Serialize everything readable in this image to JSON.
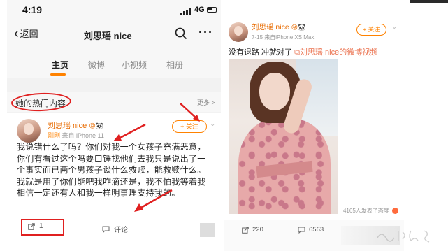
{
  "left": {
    "status": {
      "time": "4:19",
      "network": "4G"
    },
    "nav": {
      "back_label": "返回",
      "title": "刘思瑶 nice"
    },
    "tabs": [
      {
        "label": "主页",
        "active": true
      },
      {
        "label": "微博",
        "active": false
      },
      {
        "label": "小视频",
        "active": false
      },
      {
        "label": "相册",
        "active": false
      }
    ],
    "hot_section": {
      "title": "她的热门内容",
      "more_label": "更多 >"
    },
    "post": {
      "author": "刘思瑶 nice",
      "author_badges": "😝🐼",
      "time_label": "刚刚",
      "source": "来自 iPhone 11",
      "follow_label": "+ 关注",
      "text": "我说错什么了吗？你们对我一个女孩子充满恶意，你们有看过这个吗要口锤找他们去我只是说出了一个事实而已两个男孩子谈什么救赎，能救赎什么。我就是用了你们能吧我咋滴还是，我不怕我等着我相信一定还有人和我一样明事理支持我的。",
      "share_count": "1",
      "comment_label": "评论"
    }
  },
  "right": {
    "post": {
      "author": "刘思瑶 nice",
      "author_badges": "😝🐼",
      "meta": "7-15  来自iPhone XS Max",
      "follow_label": "+ 关注",
      "text_prefix": "没有退路 冲就对了 ",
      "link_text": "刘思瑶 nice的微博视频",
      "likes_text": "4165人发表了态度",
      "share_count": "220",
      "comment_count": "6563"
    }
  },
  "colors": {
    "accent": "#ff8200",
    "annotation_red": "#e02020",
    "username": "#e86b00"
  },
  "icons": [
    "signal-icon",
    "battery-icon",
    "search-icon",
    "more-icon",
    "share-icon",
    "comment-icon",
    "chevron-down-icon",
    "link-icon",
    "like-icon"
  ]
}
